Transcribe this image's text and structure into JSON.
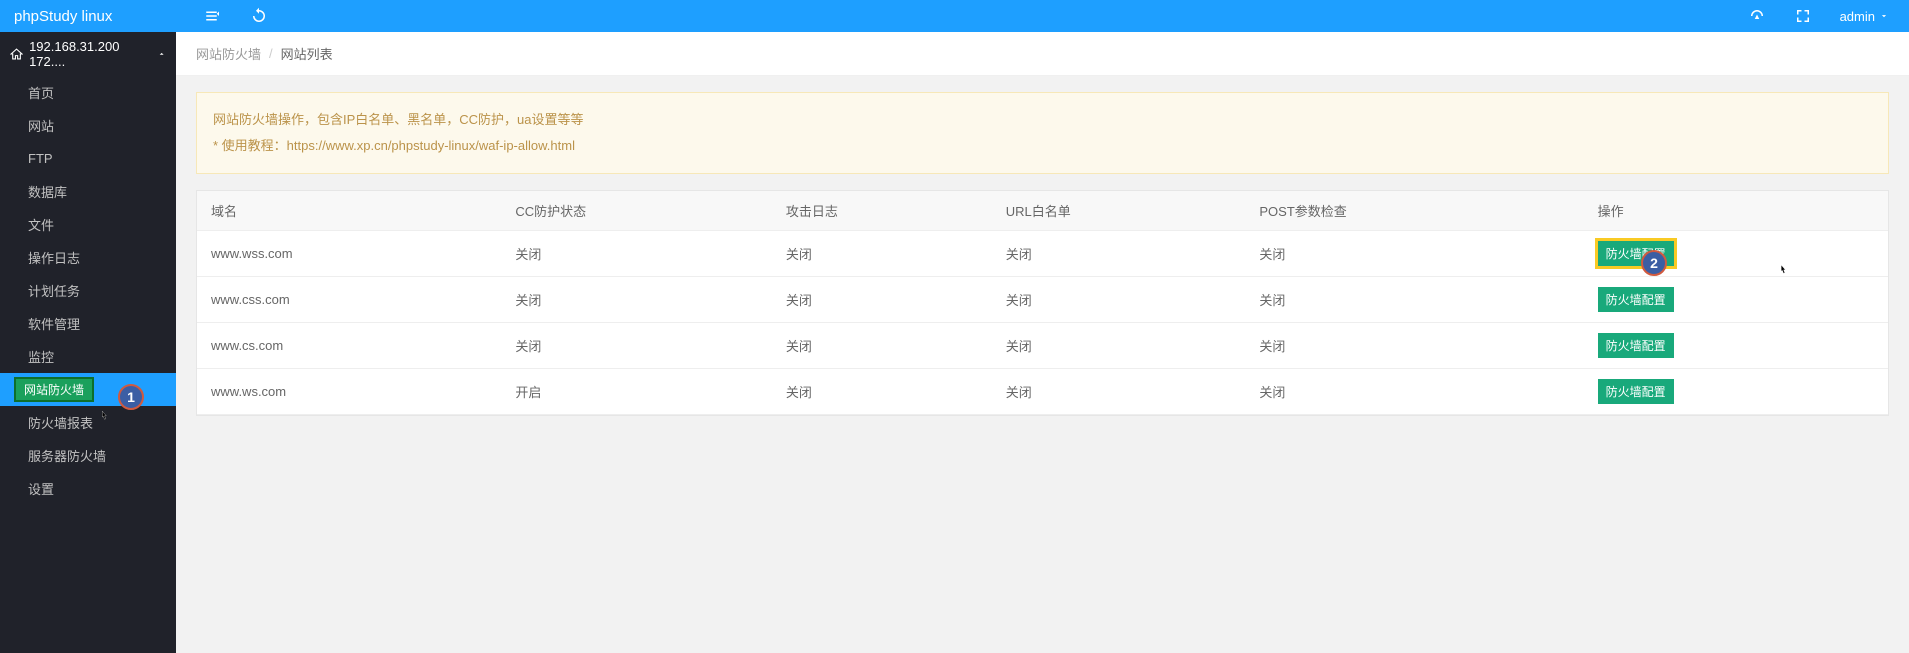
{
  "brand": "phpStudy linux",
  "topbar": {
    "admin_label": "admin"
  },
  "server": {
    "ip_display": "192.168.31.200 172...."
  },
  "menu": {
    "items": [
      {
        "label": "首页"
      },
      {
        "label": "网站"
      },
      {
        "label": "FTP"
      },
      {
        "label": "数据库"
      },
      {
        "label": "文件"
      },
      {
        "label": "操作日志"
      },
      {
        "label": "计划任务"
      },
      {
        "label": "软件管理"
      },
      {
        "label": "监控"
      },
      {
        "label": "网站防火墙",
        "active": true
      },
      {
        "label": "防火墙报表"
      },
      {
        "label": "服务器防火墙"
      },
      {
        "label": "设置"
      }
    ]
  },
  "breadcrumb": {
    "root": "网站防火墙",
    "current": "网站列表"
  },
  "tip": {
    "line1": "网站防火墙操作，包含IP白名单、黑名单，CC防护，ua设置等等",
    "line2_prefix": "* 使用教程：",
    "line2_url": "https://www.xp.cn/phpstudy-linux/waf-ip-allow.html"
  },
  "table": {
    "headers": {
      "domain": "域名",
      "cc_status": "CC防护状态",
      "attack_log": "攻击日志",
      "url_whitelist": "URL白名单",
      "post_check": "POST参数检查",
      "operation": "操作"
    },
    "config_btn_label": "防火墙配置",
    "rows": [
      {
        "domain": "www.wss.com",
        "cc": "关闭",
        "attack": "关闭",
        "url": "关闭",
        "post": "关闭",
        "highlight": true
      },
      {
        "domain": "www.css.com",
        "cc": "关闭",
        "attack": "关闭",
        "url": "关闭",
        "post": "关闭",
        "highlight": false
      },
      {
        "domain": "www.cs.com",
        "cc": "关闭",
        "attack": "关闭",
        "url": "关闭",
        "post": "关闭",
        "highlight": false
      },
      {
        "domain": "www.ws.com",
        "cc": "开启",
        "attack": "关闭",
        "url": "关闭",
        "post": "关闭",
        "highlight": false
      }
    ]
  },
  "annotations": {
    "badge1": "1",
    "badge2": "2"
  }
}
